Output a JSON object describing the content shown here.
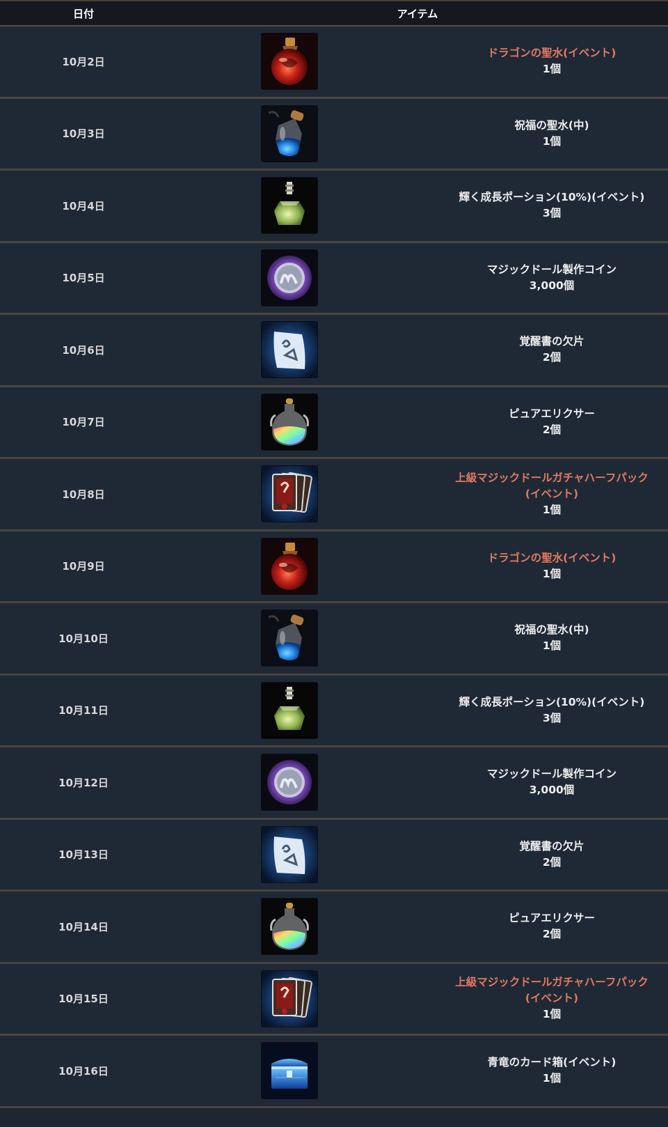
{
  "header": {
    "date_label": "日付",
    "item_label": "アイテム"
  },
  "colors": {
    "event_text": "#e07a5f",
    "normal_text": "#ededed",
    "row_bg": "#1f2936",
    "header_bg": "#15181e"
  },
  "rows": [
    {
      "date": "10月2日",
      "icon": "dragon-holy-water-icon",
      "name": "ドラゴンの聖水(イベント)",
      "name_line2": "",
      "qty": "1個",
      "event": true
    },
    {
      "date": "10月3日",
      "icon": "blessed-holy-water-icon",
      "name": "祝福の聖水(中)",
      "name_line2": "",
      "qty": "1個",
      "event": false
    },
    {
      "date": "10月4日",
      "icon": "growth-potion-icon",
      "name": "輝く成長ポーション(10%)(イベント)",
      "name_line2": "",
      "qty": "3個",
      "event": false
    },
    {
      "date": "10月5日",
      "icon": "magic-doll-coin-icon",
      "name": "マジックドール製作コイン",
      "name_line2": "",
      "qty": "3,000個",
      "event": false
    },
    {
      "date": "10月6日",
      "icon": "awakening-scroll-fragment-icon",
      "name": "覚醒書の欠片",
      "name_line2": "",
      "qty": "2個",
      "event": false
    },
    {
      "date": "10月7日",
      "icon": "pure-elixir-icon",
      "name": "ピュアエリクサー",
      "name_line2": "",
      "qty": "2個",
      "event": false
    },
    {
      "date": "10月8日",
      "icon": "magic-doll-gacha-pack-icon",
      "name": "上級マジックドールガチャハーフパック",
      "name_line2": "(イベント)",
      "qty": "1個",
      "event": true
    },
    {
      "date": "10月9日",
      "icon": "dragon-holy-water-icon",
      "name": "ドラゴンの聖水(イベント)",
      "name_line2": "",
      "qty": "1個",
      "event": true
    },
    {
      "date": "10月10日",
      "icon": "blessed-holy-water-icon",
      "name": "祝福の聖水(中)",
      "name_line2": "",
      "qty": "1個",
      "event": false
    },
    {
      "date": "10月11日",
      "icon": "growth-potion-icon",
      "name": "輝く成長ポーション(10%)(イベント)",
      "name_line2": "",
      "qty": "3個",
      "event": false
    },
    {
      "date": "10月12日",
      "icon": "magic-doll-coin-icon",
      "name": "マジックドール製作コイン",
      "name_line2": "",
      "qty": "3,000個",
      "event": false
    },
    {
      "date": "10月13日",
      "icon": "awakening-scroll-fragment-icon",
      "name": "覚醒書の欠片",
      "name_line2": "",
      "qty": "2個",
      "event": false
    },
    {
      "date": "10月14日",
      "icon": "pure-elixir-icon",
      "name": "ピュアエリクサー",
      "name_line2": "",
      "qty": "2個",
      "event": false
    },
    {
      "date": "10月15日",
      "icon": "magic-doll-gacha-pack-icon",
      "name": "上級マジックドールガチャハーフパック",
      "name_line2": "(イベント)",
      "qty": "1個",
      "event": true
    },
    {
      "date": "10月16日",
      "icon": "blue-dragon-card-box-icon",
      "name": "青竜のカード箱(イベント)",
      "name_line2": "",
      "qty": "1個",
      "event": false
    }
  ]
}
